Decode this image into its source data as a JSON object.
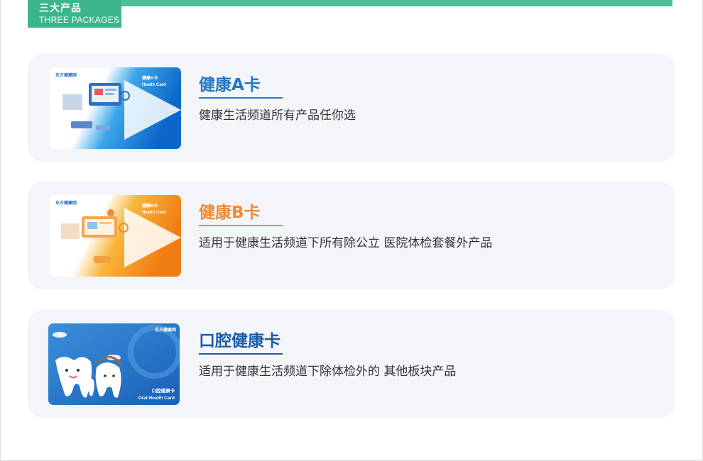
{
  "section": {
    "title_cn": "三大产品",
    "title_en": "THREE PACKAGES"
  },
  "colors": {
    "accent_green": "#3cb48e",
    "blue": "#2277c7",
    "orange": "#f08a35",
    "navy": "#1c5da8",
    "panel_bg": "#f3f5f8"
  },
  "products": [
    {
      "title": "健康A卡",
      "description": "健康生活频道所有产品任你选",
      "card": {
        "brand": "东方健康网",
        "name_cn": "健康A卡",
        "name_en": "Health Card"
      }
    },
    {
      "title": "健康B卡",
      "description": "适用于健康生活频道下所有除公立 医院体检套餐外产品",
      "card": {
        "brand": "东方健康网",
        "name_cn": "健康B卡",
        "name_en": "Health Card"
      }
    },
    {
      "title": "口腔健康卡",
      "description": "适用于健康生活频道下除体检外的 其他板块产品",
      "card": {
        "brand": "东方健康网",
        "name_cn": "口腔健康卡",
        "name_en": "Oral Health Card"
      }
    }
  ]
}
